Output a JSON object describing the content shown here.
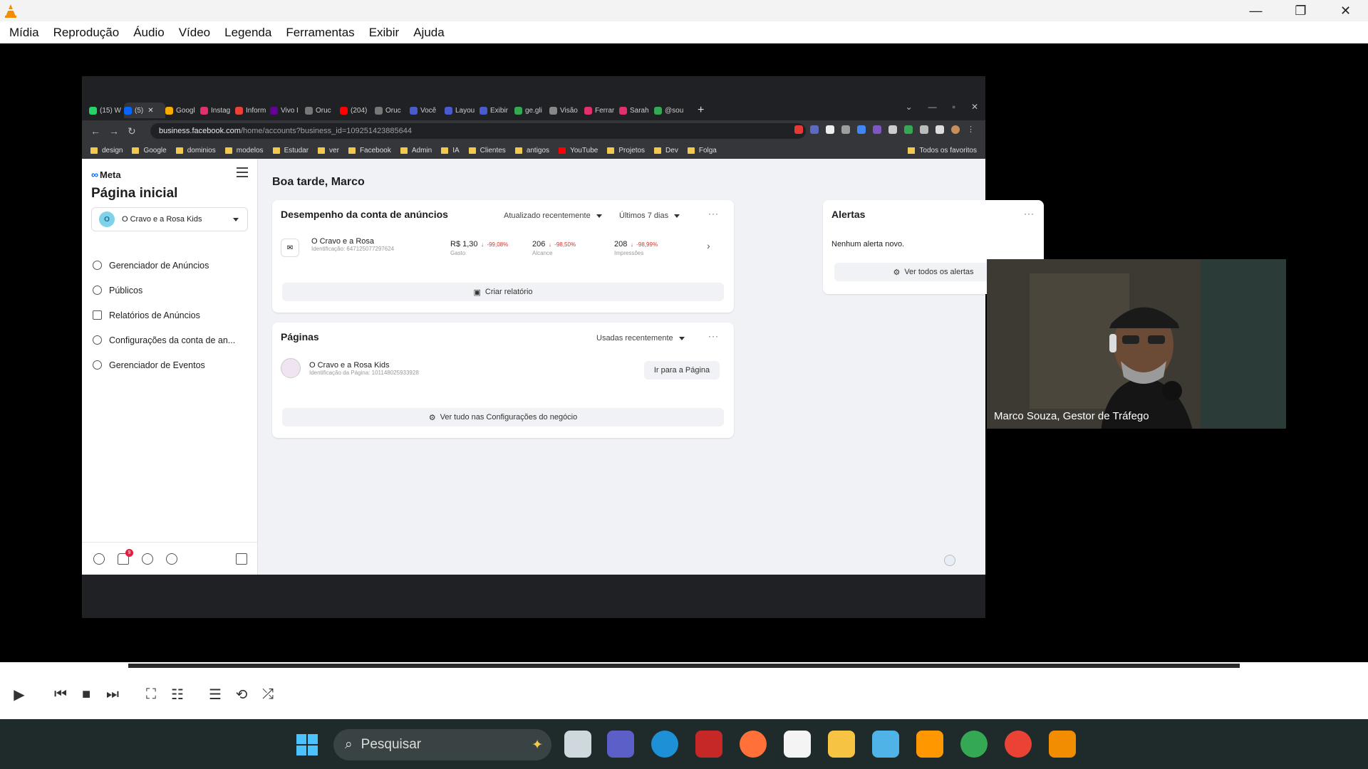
{
  "vlc": {
    "menu": [
      "Mídia",
      "Reprodução",
      "Áudio",
      "Vídeo",
      "Legenda",
      "Ferramentas",
      "Exibir",
      "Ajuda"
    ],
    "window_controls": [
      "minimize-icon",
      "restore-icon",
      "close-icon"
    ]
  },
  "browser": {
    "tabs": [
      "(15) W",
      "(5)",
      "Googl",
      "Instag",
      "Inform",
      "Vivo I",
      "Oruc",
      "(204)",
      "Oruc",
      "Você",
      "Layou",
      "Exibir",
      "ge.gli",
      "Visão",
      "Ferrar",
      "Sarah",
      "@sou"
    ],
    "url_host": "business.facebook.com",
    "url_path": "/home/accounts?business_id=109251423885644",
    "bookmarks": [
      "design",
      "Google",
      "dominios",
      "modelos",
      "Estudar",
      "ver",
      "Facebook",
      "Admin",
      "IA",
      "Clientes",
      "antigos",
      "YouTube",
      "Projetos",
      "Dev",
      "Folga"
    ],
    "bookmarks_right": "Todos os favoritos"
  },
  "meta": {
    "logo": "Meta",
    "page_title": "Página inicial",
    "account_initial": "O",
    "account_name": "O Cravo e a Rosa Kids",
    "nav": [
      "Gerenciador de Anúncios",
      "Públicos",
      "Relatórios de Anúncios",
      "Configurações da conta de an...",
      "Gerenciador de Eventos"
    ],
    "notification_count": "9",
    "greeting": "Boa tarde, Marco",
    "performance": {
      "title": "Desempenho da conta de anúncios",
      "sort": "Atualizado recentemente",
      "range": "Últimos 7 dias",
      "account_name": "O Cravo e a Rosa",
      "account_id": "Identificação: 647125077297624",
      "spend": "R$ 1,30",
      "spend_change": "-99,08%",
      "spend_label": "Gasto",
      "reach": "206",
      "reach_change": "-98,50%",
      "reach_label": "Alcance",
      "impressions": "208",
      "impressions_change": "-98,99%",
      "impressions_label": "Impressões",
      "button": "Criar relatório"
    },
    "alerts": {
      "title": "Alertas",
      "empty": "Nenhum alerta novo.",
      "button": "Ver todos os alertas"
    },
    "pages": {
      "title": "Páginas",
      "sort": "Usadas recentemente",
      "page_name": "O Cravo e a Rosa Kids",
      "page_id": "Identificação da Página: 101148025933928",
      "go_button": "Ir para a Página",
      "settings_button": "Ver tudo nas Configurações do negócio"
    }
  },
  "webcam": {
    "caption": "Marco Souza, Gestor de Tráfego"
  },
  "taskbar": {
    "search_placeholder": "Pesquisar"
  },
  "colors": {
    "meta_blue": "#0866ff",
    "negative": "#d0352e",
    "vlc_orange": "#f28c00"
  }
}
